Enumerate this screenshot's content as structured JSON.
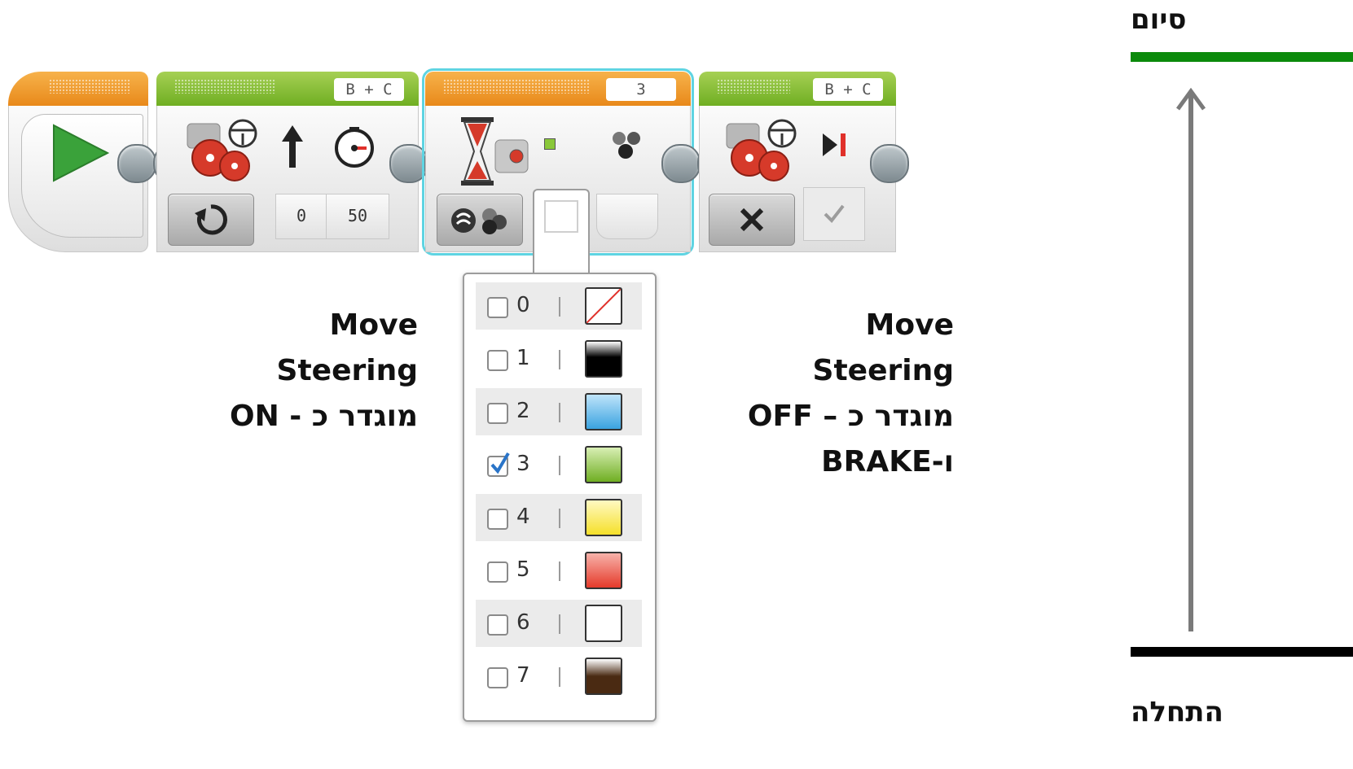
{
  "blocks": {
    "move_on": {
      "port": "B + C",
      "steering": "0",
      "power": "50"
    },
    "wait": {
      "port": "3"
    },
    "move_off": {
      "port": "B + C"
    }
  },
  "captions": {
    "left": {
      "line1": "Move",
      "line2": "Steering",
      "line3": "מוגדר כ - ON"
    },
    "right": {
      "line1": "Move",
      "line2": "Steering",
      "line3": "מוגדר כ – OFF",
      "line4": "ו-BRAKE"
    }
  },
  "color_dropdown": {
    "selected": "3",
    "items": [
      {
        "number": "0",
        "color": "none",
        "checked": false
      },
      {
        "number": "1",
        "color": "#000000",
        "checked": false
      },
      {
        "number": "2",
        "color": "#3aa3e0",
        "checked": false
      },
      {
        "number": "3",
        "color": "#7db83a",
        "checked": true
      },
      {
        "number": "4",
        "color": "#f5e02a",
        "checked": false
      },
      {
        "number": "5",
        "color": "#e53a2a",
        "checked": false
      },
      {
        "number": "6",
        "color": "#ffffff",
        "checked": false
      },
      {
        "number": "7",
        "color": "#4a2a12",
        "checked": false
      }
    ]
  },
  "timeline": {
    "end_label": "סיום",
    "start_label": "התחלה",
    "end_color": "#0b8a0b",
    "start_color": "#000000"
  }
}
